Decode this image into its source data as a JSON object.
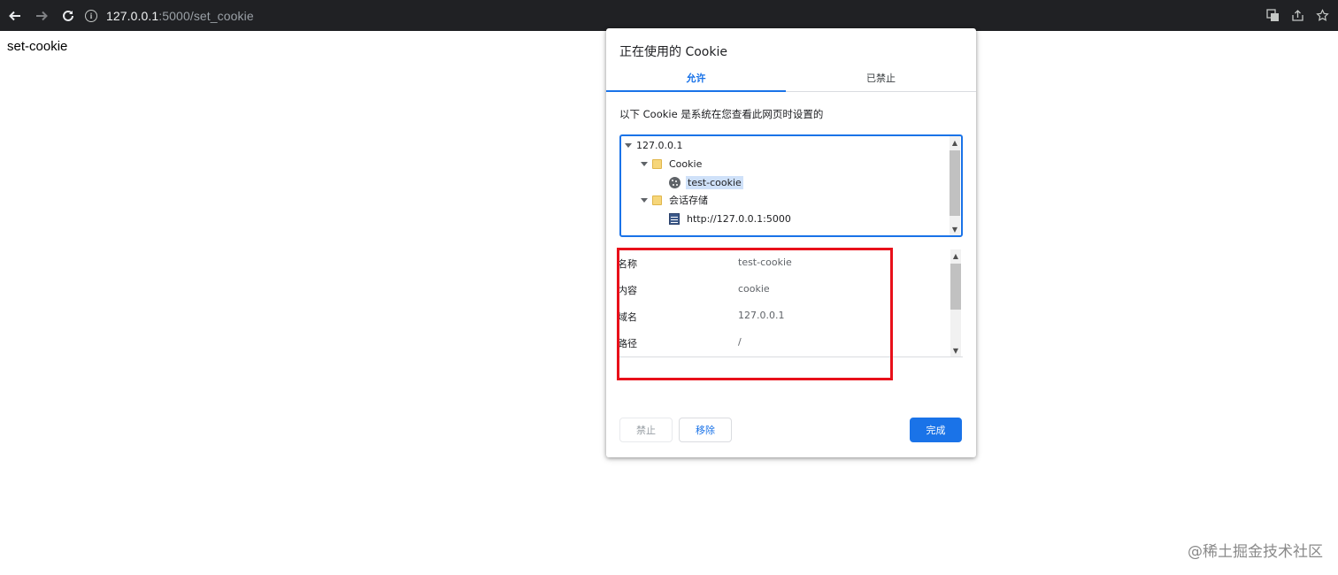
{
  "browser": {
    "url_host": "127.0.0.1",
    "url_rest": ":5000/set_cookie"
  },
  "page": {
    "text": "set-cookie"
  },
  "dialog": {
    "title": "正在使用的 Cookie",
    "tabs": [
      {
        "label": "允许",
        "active": true
      },
      {
        "label": "已禁止",
        "active": false
      }
    ],
    "description": "以下 Cookie 是系统在您查看此网页时设置的",
    "tree": {
      "site": "127.0.0.1",
      "cookie_folder": "Cookie",
      "cookie_item": "test-cookie",
      "session_folder": "会话存储",
      "session_item": "http://127.0.0.1:5000"
    },
    "details": [
      {
        "key": "名称",
        "value": "test-cookie"
      },
      {
        "key": "内容",
        "value": "cookie"
      },
      {
        "key": "域名",
        "value": "127.0.0.1"
      },
      {
        "key": "路径",
        "value": "/"
      }
    ],
    "buttons": {
      "block": "禁止",
      "remove": "移除",
      "done": "完成"
    }
  },
  "watermark": "@稀土掘金技术社区",
  "colors": {
    "accent": "#1a73e8",
    "highlight": "#e8101a",
    "toolbar": "#202124"
  }
}
